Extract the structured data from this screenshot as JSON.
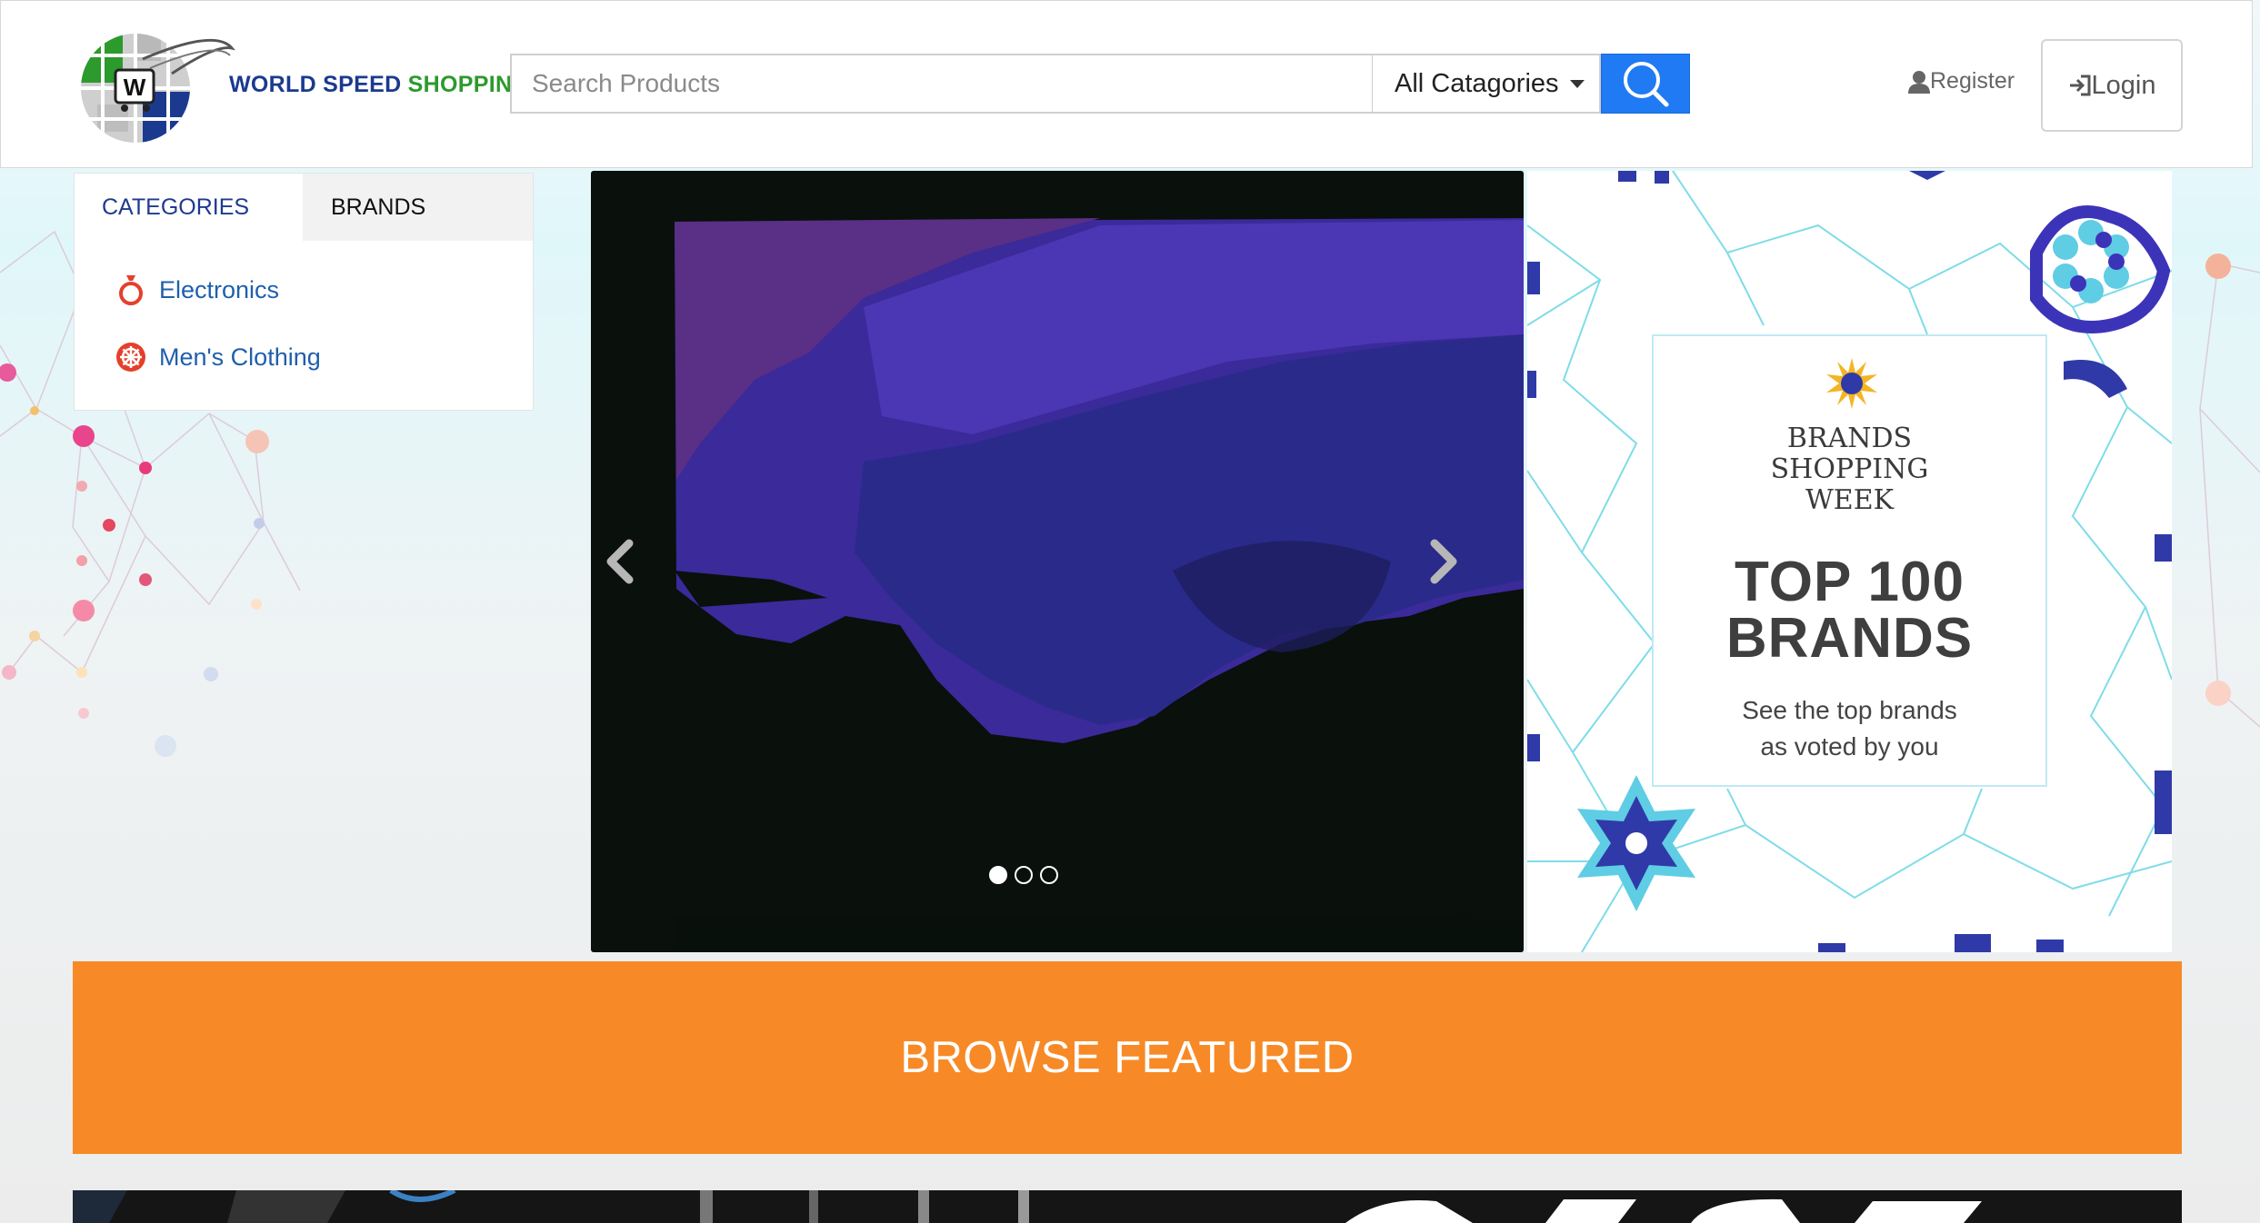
{
  "header": {
    "brand": {
      "word1": "WORLD SPEED",
      "word2": "SHOPPING",
      "logo_icon": "globe-cart-logo"
    },
    "search": {
      "placeholder": "Search Products",
      "value": ""
    },
    "category_select": {
      "selected": "All Catagories"
    },
    "search_button": {
      "icon": "search-icon"
    },
    "register_label": "Register",
    "login_label": "Login"
  },
  "sidebar": {
    "tabs": [
      {
        "label": "CATEGORIES",
        "active": true
      },
      {
        "label": "BRANDS",
        "active": false
      }
    ],
    "items": [
      {
        "label": "Electronics",
        "icon": "ring-icon"
      },
      {
        "label": "Men's Clothing",
        "icon": "wheel-icon"
      }
    ]
  },
  "carousel": {
    "slide_count": 3,
    "active_index": 0
  },
  "side_banner": {
    "title": [
      "BRANDS",
      "SHOPPING",
      "WEEK"
    ],
    "headline": [
      "TOP 100",
      "BRANDS"
    ],
    "subtitle": [
      "See the top brands",
      "as voted by you"
    ]
  },
  "browse": {
    "label": "BROWSE FEATURED"
  },
  "colors": {
    "accent": "#f78a26",
    "search_button": "#1f7af4",
    "link": "#1f5fad",
    "brand_blue": "#1b3a8f",
    "brand_green": "#2c9a2c"
  }
}
